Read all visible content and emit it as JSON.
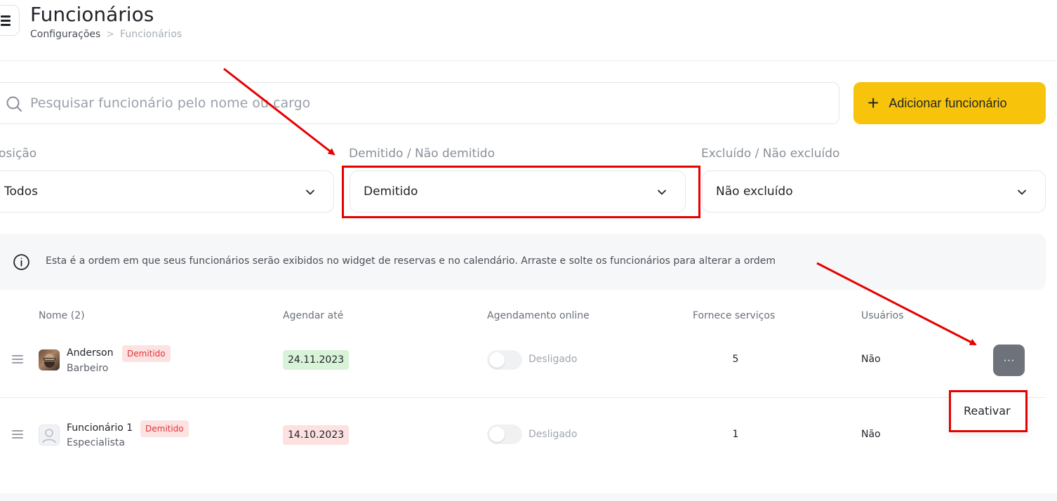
{
  "header": {
    "title": "Funcionários",
    "breadcrumb": [
      "Configurações",
      "Funcionários"
    ],
    "breadcrumb_separator": ">"
  },
  "search": {
    "placeholder": "Pesquisar funcionário pelo nome ou cargo",
    "value": ""
  },
  "add_button": {
    "label": "Adicionar funcionário",
    "color": "#f8c40b"
  },
  "filters": {
    "position": {
      "label": "osição",
      "value": "Todos"
    },
    "dismissed": {
      "label": "Demitido / Não demitido",
      "value": "Demitido"
    },
    "deleted": {
      "label": "Excluído / Não excluído",
      "value": "Não excluído"
    }
  },
  "info": {
    "text": "Esta é a ordem em que seus funcionários serão exibidos no widget de reservas e no calendário. Arraste e solte os funcionários para alterar a ordem"
  },
  "table": {
    "headers": {
      "name": "Nome (2)",
      "schedule_until": "Agendar até",
      "online_booking": "Agendamento online",
      "provides_services": "Fornece serviços",
      "users": "Usuários"
    },
    "rows": [
      {
        "name": "Anderson",
        "badge": "Demitido",
        "role": "Barbeiro",
        "date": "24.11.2023",
        "date_status": "green",
        "online": "Desligado",
        "services": "5",
        "users": "Não"
      },
      {
        "name": "Funcionário 1",
        "badge": "Demitido",
        "role": "Especialista",
        "date": "14.10.2023",
        "date_status": "red",
        "online": "Desligado",
        "services": "1",
        "users": "Não"
      }
    ]
  },
  "row_menu": {
    "button": "···",
    "option": "Reativar"
  },
  "colors": {
    "highlight": "#e60000",
    "badge_bg": "#fde2e2",
    "badge_text": "#e0343a"
  }
}
